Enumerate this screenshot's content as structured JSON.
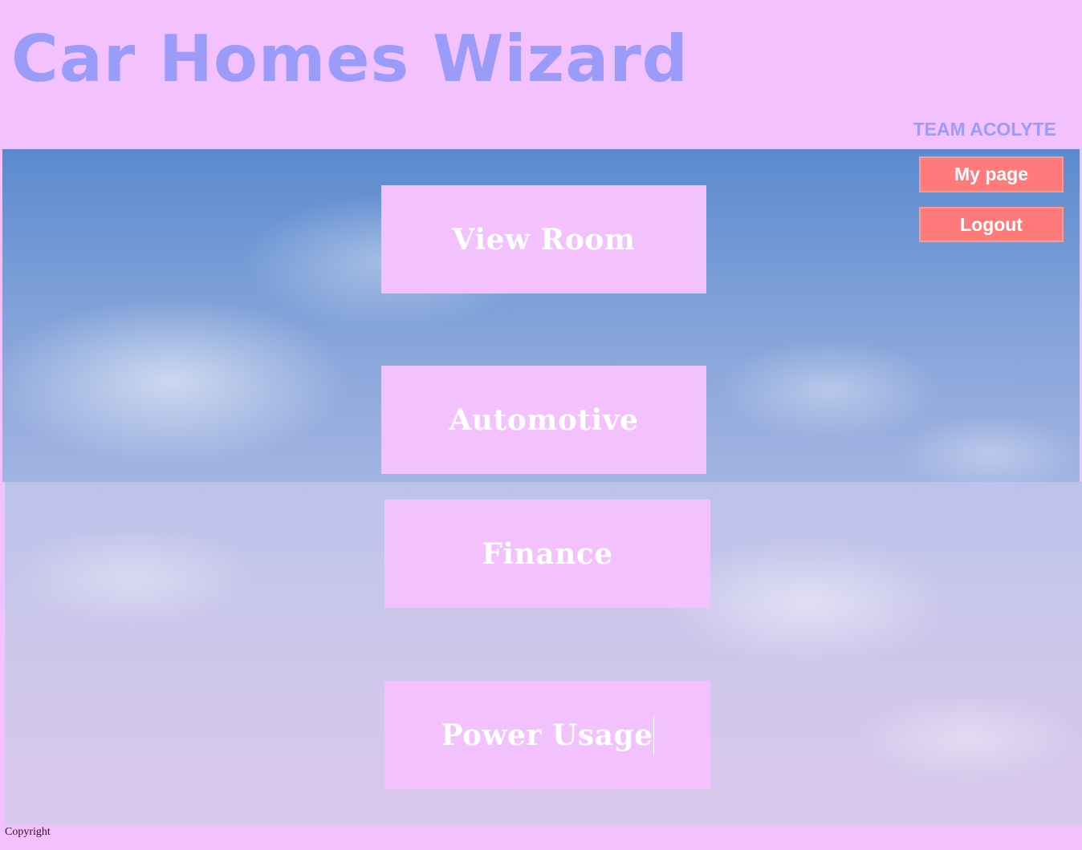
{
  "header": {
    "title": "Car Homes Wizard",
    "team": "TEAM ACOLYTE"
  },
  "account": {
    "my_page_label": "My page",
    "logout_label": "Logout"
  },
  "main": {
    "buttons": [
      {
        "label": "View Room"
      },
      {
        "label": "Automotive"
      },
      {
        "label": "Finance"
      },
      {
        "label": "Power Usage"
      }
    ]
  },
  "footer": {
    "copyright": "Copyright"
  },
  "colors": {
    "page_background": "#f2c1fe",
    "title_text": "#9b9cf9",
    "account_button": "#ff7b7b",
    "nav_button": "#f2c1fe",
    "nav_text": "#ffffff"
  },
  "icons": {
    "background": "sky-clouds-background"
  }
}
